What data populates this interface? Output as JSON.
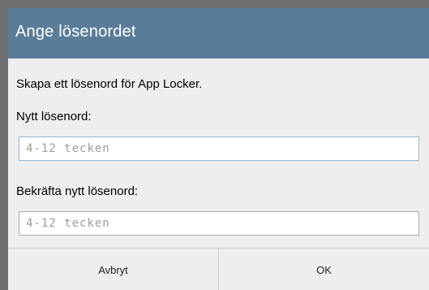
{
  "dialog": {
    "title": "Ange lösenordet",
    "message": "Skapa ett lösenord för App Locker.",
    "new_password_label": "Nytt lösenord:",
    "new_password_placeholder": "4-12 tecken",
    "confirm_password_label": "Bekräfta nytt lösenord:",
    "confirm_password_placeholder": "4-12 tecken",
    "cancel_label": "Avbryt",
    "ok_label": "OK"
  },
  "colors": {
    "titlebar": "#5b7c99",
    "dialog_background": "#eeeeee",
    "focused_input_border": "#8fb5d6"
  }
}
